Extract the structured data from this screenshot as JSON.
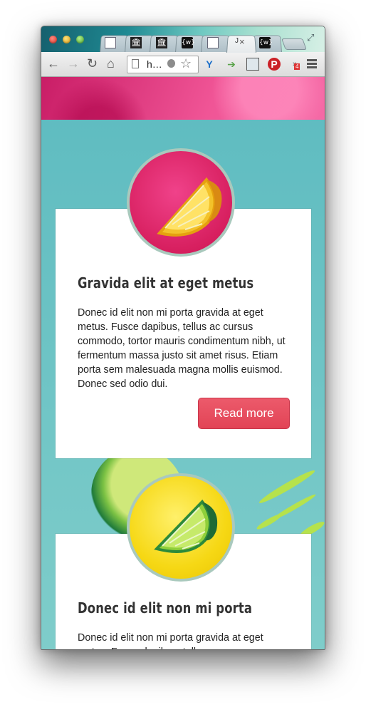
{
  "browser": {
    "address_text": "h…",
    "tab_close_glyph": "×",
    "tab_partial_text": "J",
    "tabs": [
      {
        "icon": "page-icon"
      },
      {
        "icon": "bank-icon"
      },
      {
        "icon": "bank-icon"
      },
      {
        "icon": "wordpress-w-icon"
      },
      {
        "icon": "page-icon"
      },
      {
        "icon": "page-icon",
        "active": true
      },
      {
        "icon": "wordpress-w-icon"
      }
    ],
    "extensions": [
      "y-extension-icon",
      "forward-extension-icon",
      "tab-extension-icon",
      "pinterest-icon",
      "badge-extension-icon"
    ]
  },
  "cards": [
    {
      "fruit": "lemon-slice",
      "title": "Gravida elit at eget metus",
      "body": "Donec id elit non mi porta gravida at eget metus. Fusce dapibus, tellus ac cursus commodo, tortor mauris condimentum nibh, ut fermentum massa justo sit amet risus. Etiam porta sem malesuada magna mollis euismod. Donec sed odio dui.",
      "button": "Read more"
    },
    {
      "fruit": "lime-slice",
      "title": "Donec id elit non mi porta",
      "body": "Donec id elit non mi porta gravida at eget metus. Fusce dapibus, tellus ac cursus"
    }
  ],
  "colors": {
    "hero": "#f05596",
    "background": "#66bfc1",
    "button": "#e24456",
    "badge_pink": "#d71f5f",
    "badge_yellow": "#f6d815"
  }
}
